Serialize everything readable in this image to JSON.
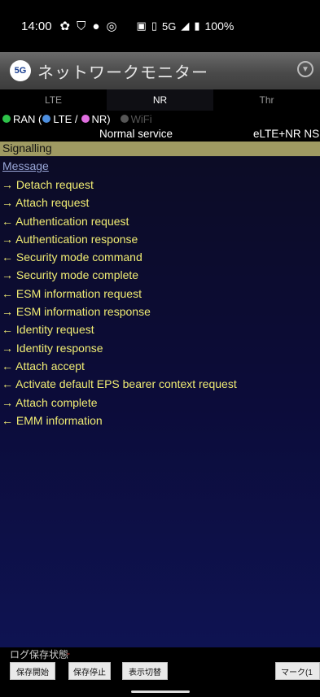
{
  "status_bar": {
    "time": "14:00",
    "network": "5G",
    "battery": "100%"
  },
  "app": {
    "logo_text": "5G",
    "title": "ネットワークモニター"
  },
  "tabs": [
    {
      "label": "LTE"
    },
    {
      "label": "NR"
    },
    {
      "label": "Thr"
    }
  ],
  "legend": {
    "ran": "RAN (",
    "lte": "LTE /",
    "nr": "NR)",
    "wifi": "WiFi",
    "colors": {
      "ran": "#2ec34a",
      "lte": "#4d8fe0",
      "nr": "#e06ee0",
      "wifi": "#555555"
    }
  },
  "service": {
    "state": "Normal service",
    "mode": "eLTE+NR NS"
  },
  "section_title": "Signalling",
  "message_header": "Message",
  "messages": [
    "→ Detach request",
    "→ Attach request",
    "← Authentication request",
    "→ Authentication response",
    "← Security mode command",
    "→ Security mode complete",
    "← ESM information request",
    "→ ESM information response",
    "← Identity request",
    "→ Identity response",
    "← Attach accept",
    "← Activate default EPS bearer context request",
    "→ Attach complete",
    "← EMM information"
  ],
  "bottom": {
    "log_label": "ログ保存状態",
    "log_state": "-",
    "buttons": {
      "start": "保存開始",
      "stop": "保存停止",
      "toggle": "表示切替",
      "mark": "マーク(1"
    }
  }
}
